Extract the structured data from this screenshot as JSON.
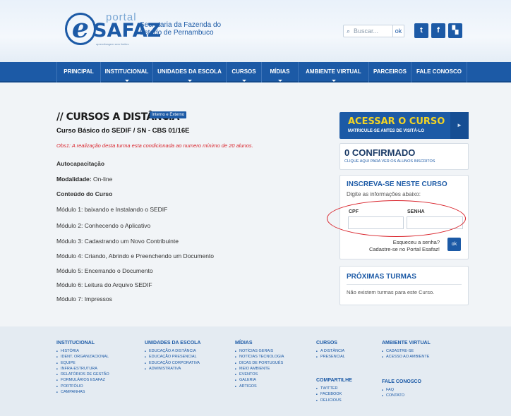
{
  "header": {
    "logo_portal": "portal",
    "logo_safaz": "SAFAZ",
    "logo_tagline": "aprendizagem sem limites",
    "secretaria_line1": "Secretaria da Fazenda do",
    "secretaria_line2": "Estado de Pernambuco",
    "search_placeholder": "Buscar...",
    "search_button": "ok",
    "social": [
      "twitter-icon",
      "facebook-icon",
      "delicious-icon"
    ]
  },
  "nav": {
    "items": [
      "PRINCIPAL",
      "INSTITUCIONAL",
      "UNIDADES DA ESCOLA",
      "CURSOS",
      "MÍDIAS",
      "AMBIENTE VIRTUAL",
      "PARCEIROS",
      "FALE CONOSCO"
    ]
  },
  "main": {
    "title": "// CURSOS A DISTÂNCIA",
    "badge": "Interno e Externo",
    "subtitle": "Curso Básico do SEDIF / SN - CBS 01/16E",
    "obs": "Obs1: A realização desta turma esta condicionada ao numero mínimo de 20 alunos.",
    "autocap": "Autocapacitação",
    "modalidade_label": "Modalidade:",
    "modalidade_value": "On-line",
    "conteudo": "Conteúdo do Curso",
    "modulos": [
      "Módulo 1: baixando e Instalando o SEDIF",
      "Módulo 2: Conhecendo o Aplicativo",
      "Módulo 3: Cadastrando um Novo Contribuinte",
      "Módulo 4: Criando, Abrindo e Preenchendo um Documento",
      "Módulo 5: Encerrando o Documento",
      "Módulo 6: Leitura do Arquivo SEDIF",
      "Módulo 7: Impressos"
    ]
  },
  "sidebar": {
    "acessar_title": "ACESSAR O CURSO",
    "acessar_sub": "MATRICULE-SE ANTES DE VISITÁ-LO",
    "acessar_arrow": "►",
    "confirmado_title": "0 CONFIRMADO",
    "confirmado_sub": "CLIQUE AQUI PARA VER OS ALUNOS INSCRITOS",
    "inscreva_title": "INSCREVA-SE NESTE CURSO",
    "inscreva_sub": "Digite as informações abaixo:",
    "cpf_label": "CPF",
    "senha_label": "SENHA",
    "esqueceu": "Esqueceu a senha?",
    "cadastre": "Cadastre-se no Portal Esafaz!",
    "ok": "ok",
    "proximas_title": "PRÓXIMAS TURMAS",
    "proximas_text": "Não existem turmas para este Curso."
  },
  "footer": {
    "institucional": {
      "head": "INSTITUCIONAL",
      "items": [
        "HISTÓRIA",
        "IDENT. ORGANIZACIONAL",
        "EQUIPE",
        "INFRA-ESTRUTURA",
        "RELATÓRIOS DE GESTÃO",
        "FORMULÁRIOS ESAFAZ",
        "PORTFÓLIO",
        "CAMPANHAS"
      ]
    },
    "unidades": {
      "head": "UNIDADES DA ESCOLA",
      "items": [
        "EDUCAÇÃO A DISTÂNCIA",
        "EDUCAÇÃO PRESENCIAL",
        "EDUCAÇÃO CORPORATIVA",
        "ADMINISTRATIVA"
      ]
    },
    "midias": {
      "head": "MÍDIAS",
      "items": [
        "NOTÍCIAS GERAIS",
        "NOTÍCIAS TECNOLOGIA",
        "DICAS DE PORTUGUÊS",
        "MEIO AMBIENTE",
        "EVENTOS",
        "GALERIA",
        "ARTIGOS"
      ]
    },
    "cursos": {
      "head": "CURSOS",
      "items": [
        "A DISTÂNCIA",
        "PRESENCIAL"
      ]
    },
    "compartilhe": {
      "head": "COMPARTILHE",
      "items": [
        "TWITTER",
        "FACEBOOK",
        "DELICIOUS"
      ]
    },
    "ambiente": {
      "head": "AMBIENTE VIRTUAL",
      "items": [
        "CADASTRE-SE",
        "ACESSO AO AMBIENTE"
      ]
    },
    "fale": {
      "head": "FALE CONOSCO",
      "items": [
        "FAQ",
        "CONTATO"
      ]
    }
  }
}
